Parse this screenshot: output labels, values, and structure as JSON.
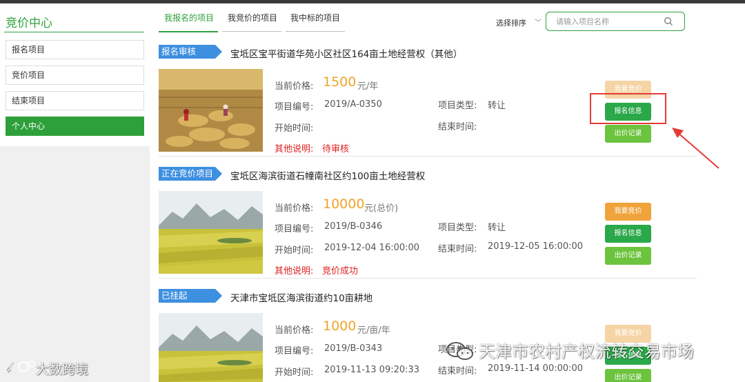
{
  "sidebar": {
    "title": "竞价中心",
    "items": [
      {
        "label": "报名项目",
        "active": false
      },
      {
        "label": "竞价项目",
        "active": false
      },
      {
        "label": "结束项目",
        "active": false
      },
      {
        "label": "个人中心",
        "active": true
      }
    ]
  },
  "tabs": [
    {
      "label": "我报名的项目",
      "active": true
    },
    {
      "label": "我竞价的项目",
      "active": false
    },
    {
      "label": "我中标的项目",
      "active": false
    }
  ],
  "toolbar": {
    "sort_label": "选择排序",
    "search_placeholder": "请输入项目名称"
  },
  "labels": {
    "current_price": "当前价格:",
    "project_no": "项目编号:",
    "project_type": "项目类型:",
    "start_time": "开始时间:",
    "end_time": "结束时间:",
    "other_note": "其他说明:"
  },
  "buttons": {
    "bid": "我要竞价",
    "signup_info": "报名信息",
    "bid_record": "出价记录"
  },
  "projects": [
    {
      "status": "报名审核",
      "title": "宝坻区宝平街道华苑小区社区164亩土地经营权（其他）",
      "price": "1500",
      "unit": "元/年",
      "number": "2019/A-0350",
      "type": "转让",
      "start": "",
      "end": "",
      "note": "待审核"
    },
    {
      "status": "正在竞价项目",
      "title": "宝坻区海滨街道石幢南社区约100亩土地经营权",
      "price": "10000",
      "unit": "元(总价)",
      "number": "2019/B-0346",
      "type": "转让",
      "start": "2019-12-04 16:00:00",
      "end": "2019-12-05 16:00:00",
      "note": "竞价成功"
    },
    {
      "status": "已挂起",
      "title": "天津市宝坻区海滨街道约10亩耕地",
      "price": "1000",
      "unit": "元/亩/年",
      "number": "2019/B-0343",
      "type": "",
      "start": "2019-11-13 09:20:33",
      "end": "2019-11-14 00:00:00",
      "note": ""
    }
  ],
  "watermarks": {
    "left": "大数跨境",
    "right": "天津市农村产权流转交易市场"
  },
  "colors": {
    "primary_green": "#2ea03a",
    "badge_blue": "#3d8fe0",
    "price_orange": "#f0a32a",
    "button_orange": "#f0a33a",
    "button_green": "#2aa84a",
    "button_light_green": "#6cc33d",
    "note_red": "#e02020",
    "annotation_red": "#e53935"
  }
}
